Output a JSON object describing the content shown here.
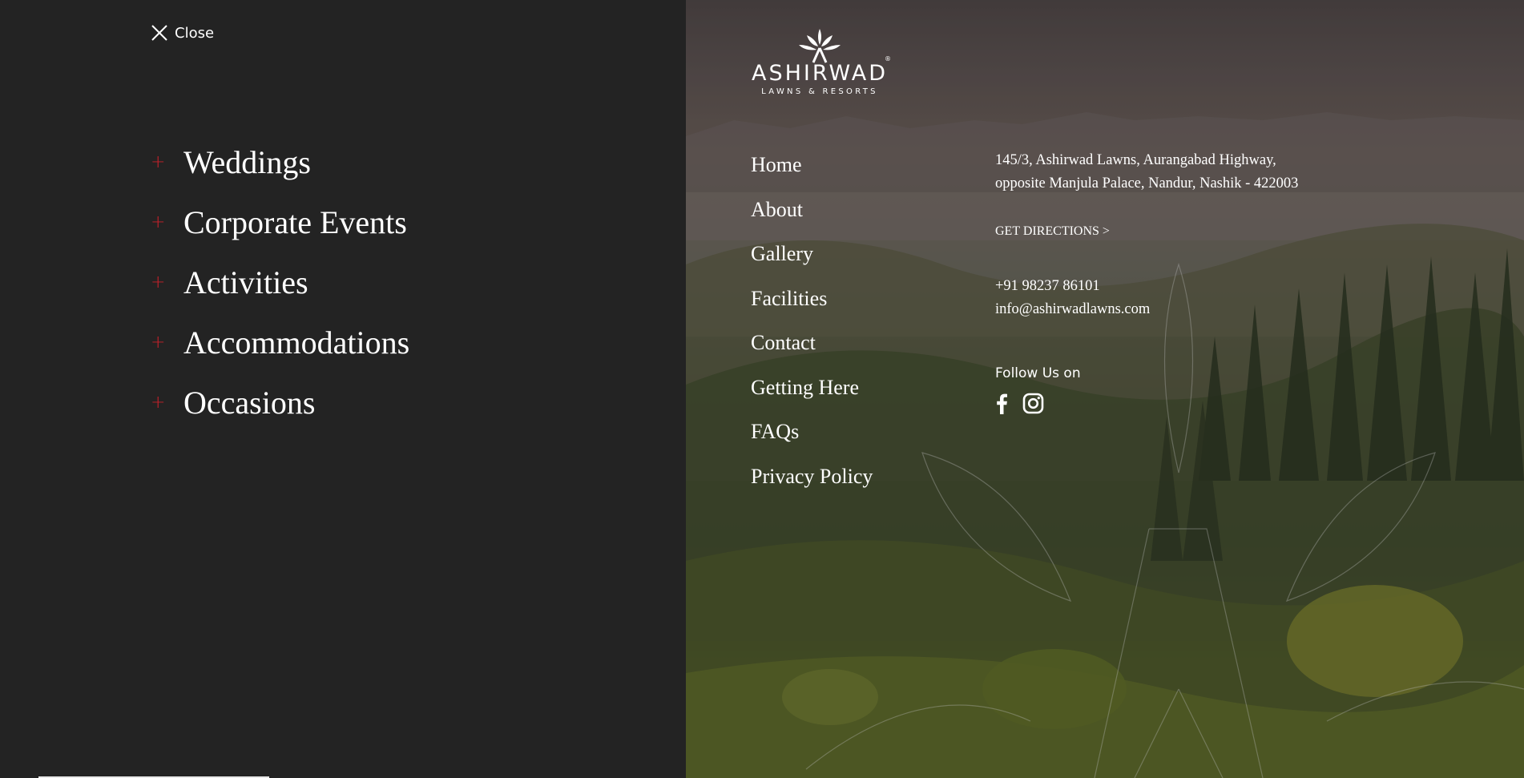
{
  "header": {
    "close_label": "Close"
  },
  "main_menu": {
    "items": [
      {
        "label": "Weddings",
        "icon": "plus-icon"
      },
      {
        "label": "Corporate Events",
        "icon": "plus-icon"
      },
      {
        "label": "Activities",
        "icon": "plus-icon"
      },
      {
        "label": "Accommodations",
        "icon": "plus-icon"
      },
      {
        "label": "Occasions",
        "icon": "plus-icon"
      }
    ],
    "expand_symbol": "+"
  },
  "logo": {
    "brand": "ASHIRWAD",
    "tagline": "LAWNS & RESORTS",
    "registered": "®"
  },
  "nav": {
    "items": [
      "Home",
      "About",
      "Gallery",
      "Facilities",
      "Contact",
      "Getting Here",
      "FAQs",
      "Privacy Policy"
    ]
  },
  "contact": {
    "address_line1": "145/3, Ashirwad Lawns, Aurangabad Highway,",
    "address_line2": "opposite Manjula Palace, Nandur, Nashik - 422003",
    "directions": "GET DIRECTIONS >",
    "phone": "+91 98237 86101",
    "email": "info@ashirwadlawns.com"
  },
  "social": {
    "heading": "Follow Us on",
    "icons": [
      "facebook-icon",
      "instagram-icon"
    ]
  },
  "colors": {
    "panel_bg": "#232323",
    "accent_red": "#c8202a",
    "text": "#ffffff"
  }
}
